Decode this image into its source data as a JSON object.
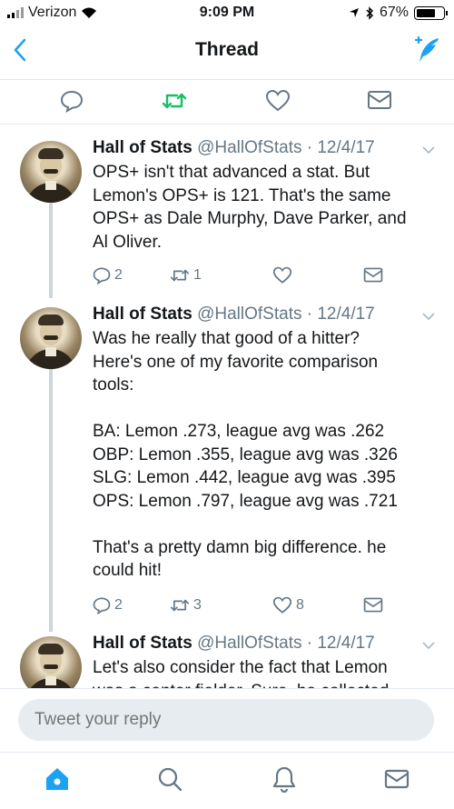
{
  "status_bar": {
    "carrier": "Verizon",
    "time": "9:09 PM",
    "battery": "67%"
  },
  "nav": {
    "title": "Thread"
  },
  "tweets": [
    {
      "name": "Hall of Stats",
      "handle": "@HallOfStats",
      "date": "· 12/4/17",
      "lines": [
        "OPS+ isn't that advanced a stat. But",
        "Lemon's OPS+ is 121. That's the same",
        "OPS+ as Dale Murphy, Dave Parker, and",
        "Al Oliver."
      ],
      "replies": "2",
      "retweets": "1",
      "likes": ""
    },
    {
      "name": "Hall of Stats",
      "handle": "@HallOfStats",
      "date": "· 12/4/17",
      "lines": [
        "Was he really that good of a hitter?",
        "Here's one of my favorite comparison",
        "tools:",
        "",
        "BA: Lemon .273, league avg was .262",
        "OBP: Lemon .355, league avg was .326",
        "SLG: Lemon .442, league avg was .395",
        "OPS: Lemon .797, league avg was .721",
        "",
        "That's a pretty damn big difference. he",
        "could hit!"
      ],
      "replies": "2",
      "retweets": "3",
      "likes": "8"
    },
    {
      "name": "Hall of Stats",
      "handle": "@HallOfStats",
      "date": "· 12/4/17",
      "lines": [
        "Let's also consider the fact that Lemon",
        "was a center fielder. Sure, he collected"
      ]
    }
  ],
  "reply": {
    "placeholder": "Tweet your reply"
  },
  "colors": {
    "accent": "#1da1f2",
    "retweet_green": "#17bf63",
    "muted": "#657786"
  }
}
